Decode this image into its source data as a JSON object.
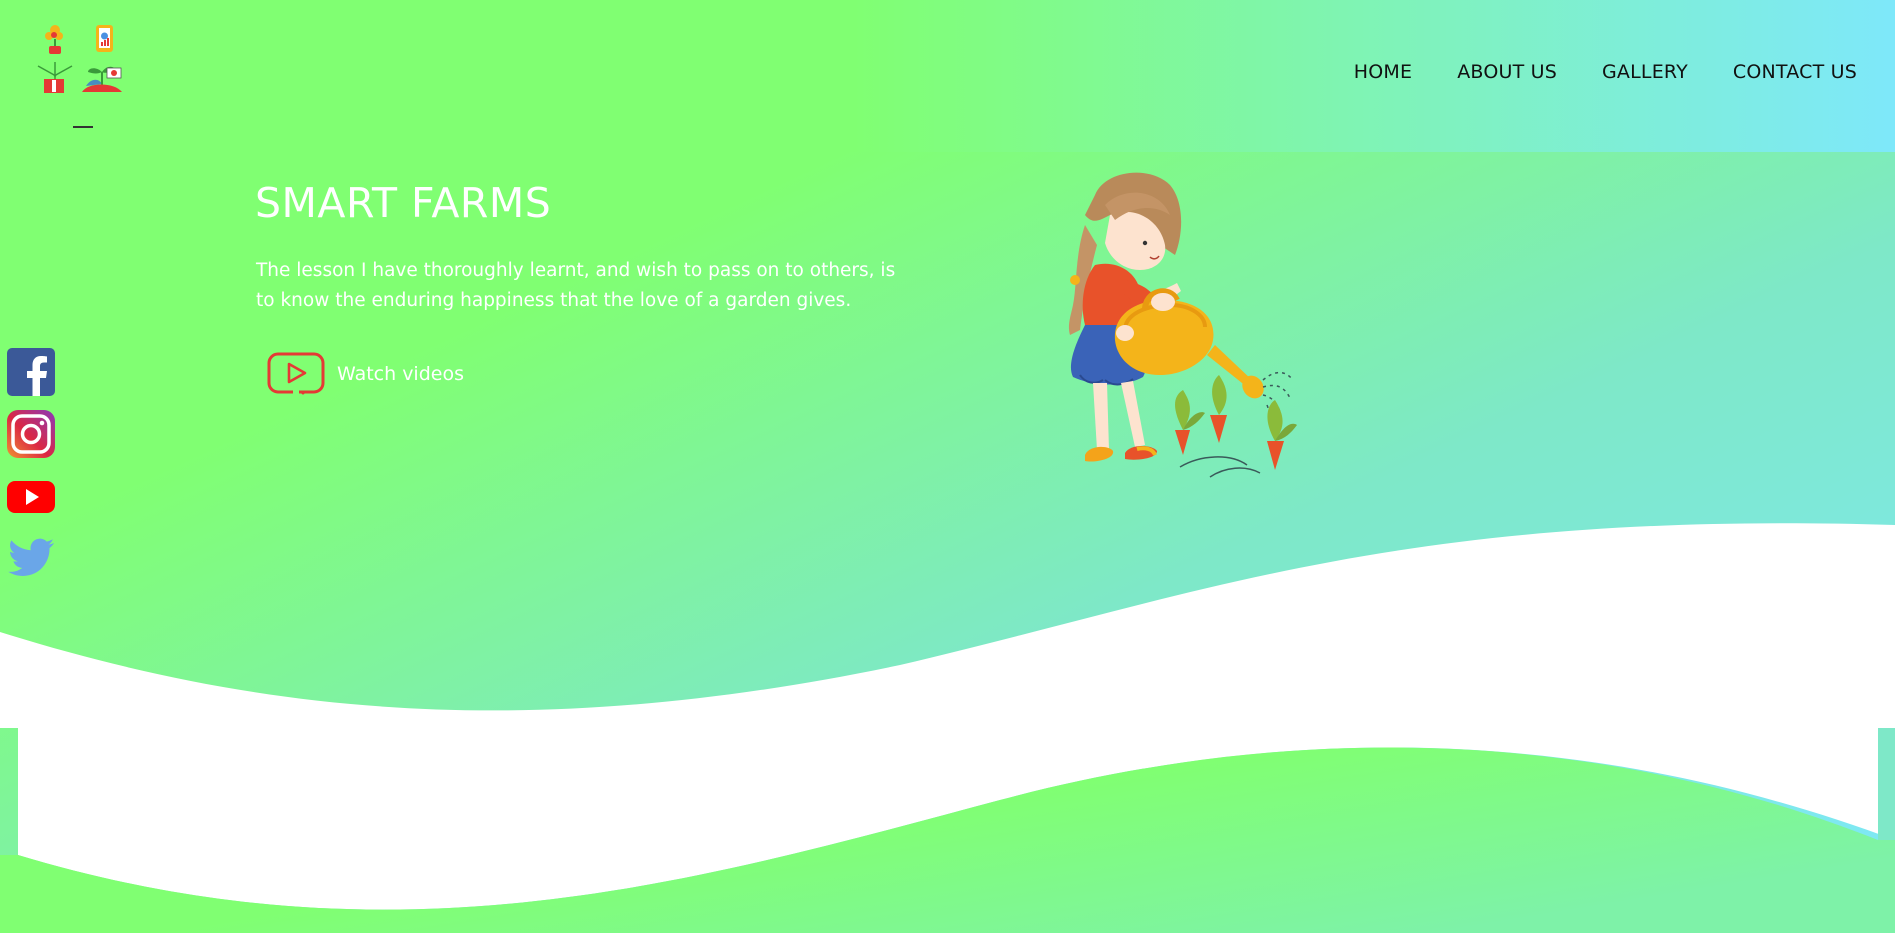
{
  "header": {
    "nav": [
      {
        "label": "HOME"
      },
      {
        "label": "ABOUT US"
      },
      {
        "label": "GALLERY"
      },
      {
        "label": "CONTACT US"
      }
    ]
  },
  "hero": {
    "title": "SMART FARMS",
    "text": "The lesson I have thoroughly learnt, and wish to pass on to others, is to know the enduring happiness that the love of a garden gives.",
    "watch_label": "Watch videos"
  },
  "social": [
    {
      "icon": "facebook-icon",
      "color": "#3b5998"
    },
    {
      "icon": "instagram-icon",
      "color": "#c13584"
    },
    {
      "icon": "youtube-icon",
      "color": "#ff0000"
    },
    {
      "icon": "twitter-icon",
      "color": "#6aa6e8"
    }
  ],
  "colors": {
    "green": "#80ff72",
    "cyan": "#7ee8fa",
    "youtube_red": "#e53935"
  }
}
